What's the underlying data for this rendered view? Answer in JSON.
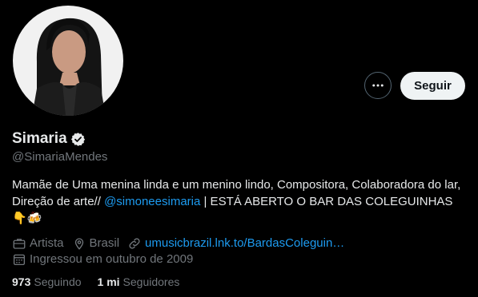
{
  "profile": {
    "display_name": "Simaria",
    "handle": "@SimariaMendes",
    "bio": {
      "text_before": "Mamãe de Uma menina linda e um menino lindo, Compositora, Colaboradora do lar, Direção de arte// ",
      "mention": "@simoneesimaria",
      "text_after": " | ESTÁ ABERTO O BAR DAS COLEGUINHAS ",
      "emoji": "👇🍻"
    },
    "meta": {
      "category": "Artista",
      "location": "Brasil",
      "link": "umusicbrazil.lnk.to/BardasColeguin…",
      "joined": "Ingressou em outubro de 2009"
    },
    "counts": {
      "following_value": "973",
      "following_label": "Seguindo",
      "followers_value": "1 mi",
      "followers_label": "Seguidores"
    }
  },
  "actions": {
    "follow_label": "Seguir",
    "more_icon": "more-horizontal-icon"
  },
  "colors": {
    "background": "#000000",
    "text_primary": "#e7e9ea",
    "text_secondary": "#71767b",
    "link": "#1d9bf0",
    "button_bg": "#eff3f4",
    "verified_badge": "#e7e9ea"
  }
}
